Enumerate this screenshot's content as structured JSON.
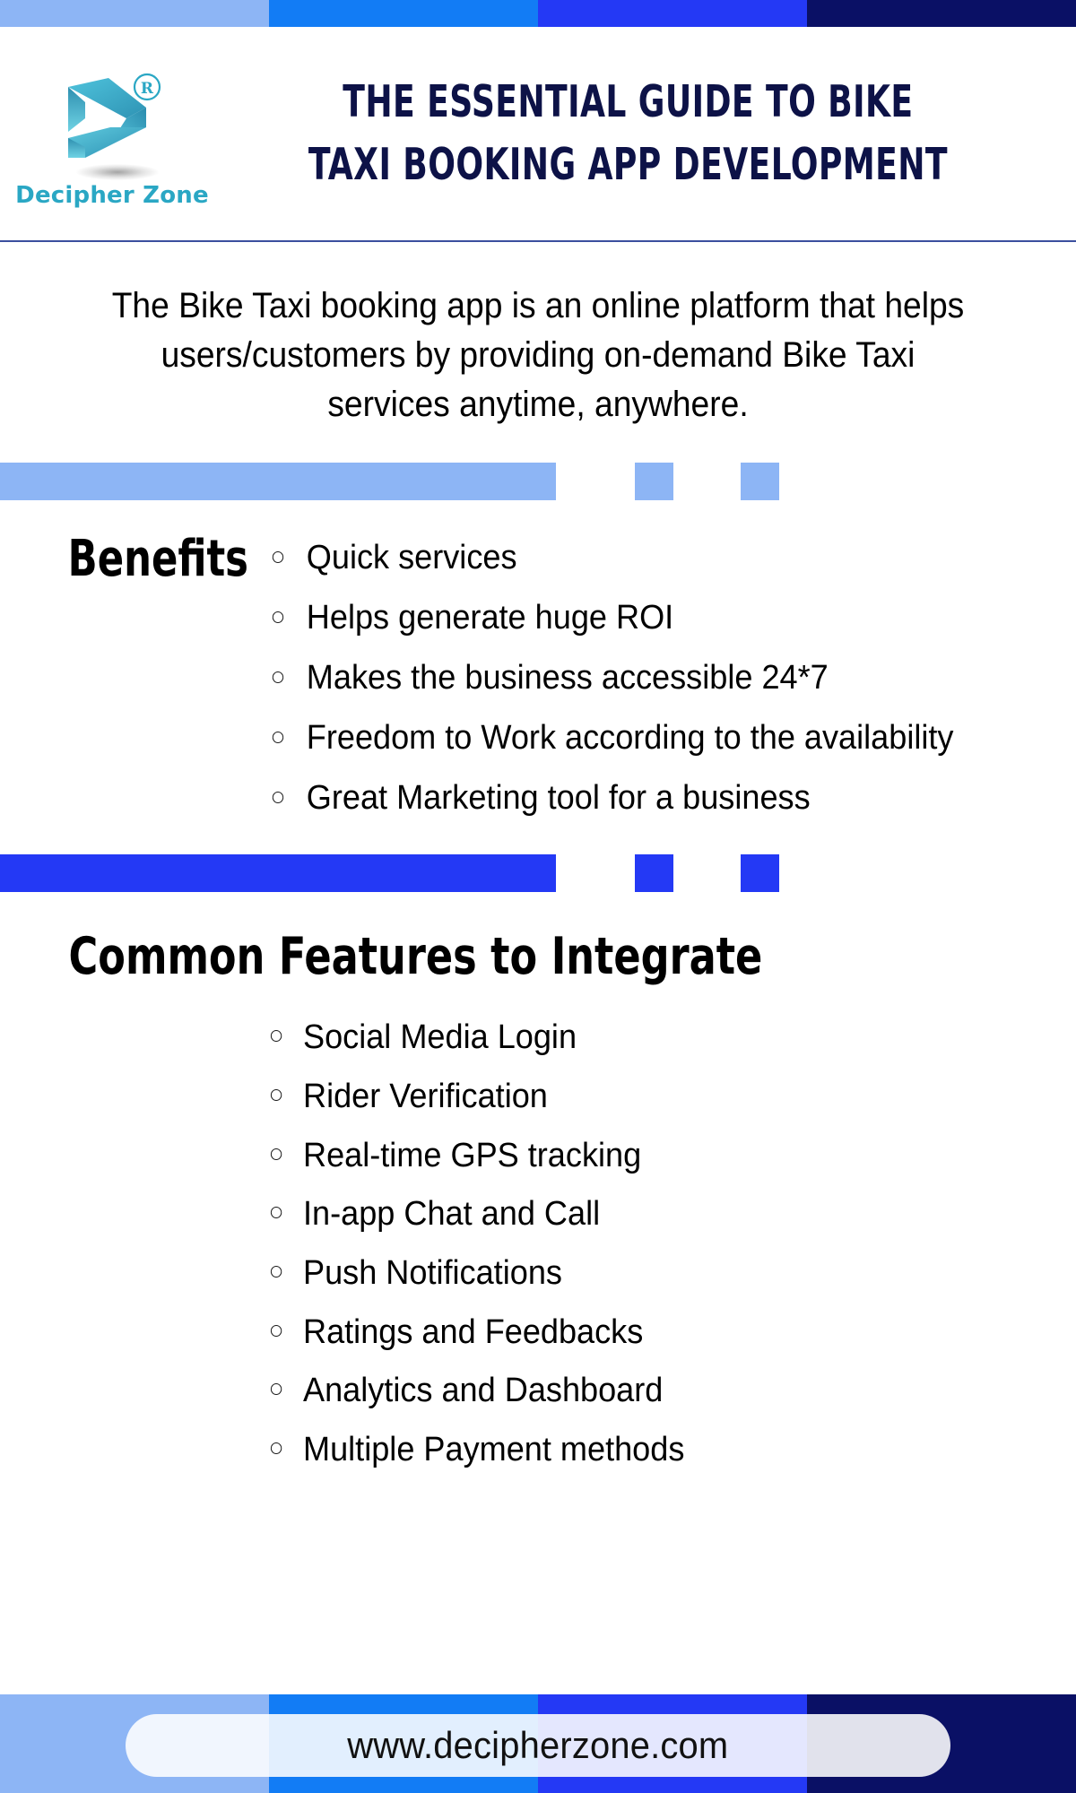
{
  "palette": {
    "light_blue": "#8DB5F5",
    "azure_blue": "#127CF5",
    "royal_blue": "#2439F5",
    "navy": "#0A1065",
    "logo_teal": "#2AA7C4",
    "title_navy": "#0D1247",
    "divider_line": "#3B4F9E"
  },
  "top_strip": {
    "segments": [
      "light_blue",
      "azure_blue",
      "royal_blue",
      "navy"
    ]
  },
  "header": {
    "logo": {
      "mark_name": "decipher-zone-arrow-logo",
      "trademark_symbol": "®",
      "wordmark": "Decipher Zone"
    },
    "title_line_1": "THE ESSENTIAL GUIDE TO BIKE",
    "title_line_2": "TAXI BOOKING APP DEVELOPMENT"
  },
  "intro": {
    "text": "The Bike Taxi booking app is an online platform that helps users/customers by providing on-demand Bike Taxi services anytime, anywhere."
  },
  "divider_light": {
    "color": "#8DB5F5"
  },
  "divider_royal": {
    "color": "#2439F5"
  },
  "benefits": {
    "heading": "Benefits",
    "items": [
      "Quick services",
      "Helps generate huge ROI",
      "Makes the business accessible 24*7",
      "Freedom to Work according to the availability",
      "Great Marketing tool for a business"
    ]
  },
  "features": {
    "heading": "Common Features to Integrate",
    "items": [
      "Social Media Login",
      "Rider Verification",
      "Real-time GPS tracking",
      "In-app Chat and Call",
      "Push Notifications",
      "Ratings and Feedbacks",
      "Analytics and Dashboard",
      "Multiple Payment methods"
    ]
  },
  "footer": {
    "url": "www.decipherzone.com",
    "segments": [
      "light_blue",
      "azure_blue",
      "royal_blue",
      "navy"
    ]
  }
}
